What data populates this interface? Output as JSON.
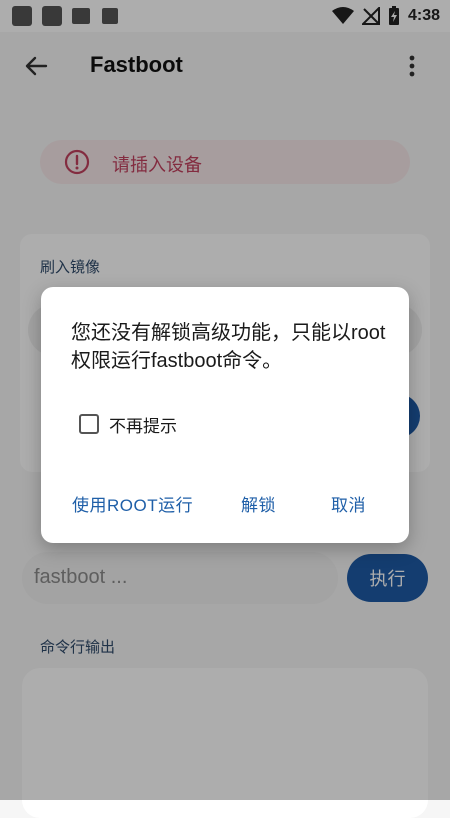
{
  "status_bar": {
    "time": "4:38",
    "icons": [
      "notification-square-icon",
      "notification-square-icon",
      "image-icon",
      "font-icon",
      "wifi-icon",
      "no-signal-icon",
      "battery-charging-icon"
    ]
  },
  "app_bar": {
    "title": "Fastboot",
    "back_icon": "arrow-back-icon",
    "menu_icon": "more-vert-icon"
  },
  "alert": {
    "icon": "error-icon",
    "text": "请插入设备",
    "color": "#c2425f"
  },
  "flash_card": {
    "title": "刷入镜像"
  },
  "command": {
    "input_value": "fastboot ...",
    "execute_label": "执行"
  },
  "output": {
    "label": "命令行输出"
  },
  "dialog": {
    "message": "您还没有解锁高级功能，只能以root权限运行fastboot命令。",
    "checkbox_label": "不再提示",
    "checkbox_checked": false,
    "actions": {
      "run_root": "使用ROOT运行",
      "unlock": "解锁",
      "cancel": "取消"
    }
  },
  "colors": {
    "accent": "#1e5aa5",
    "action_text": "#1f5fa8",
    "error": "#c2425f"
  }
}
